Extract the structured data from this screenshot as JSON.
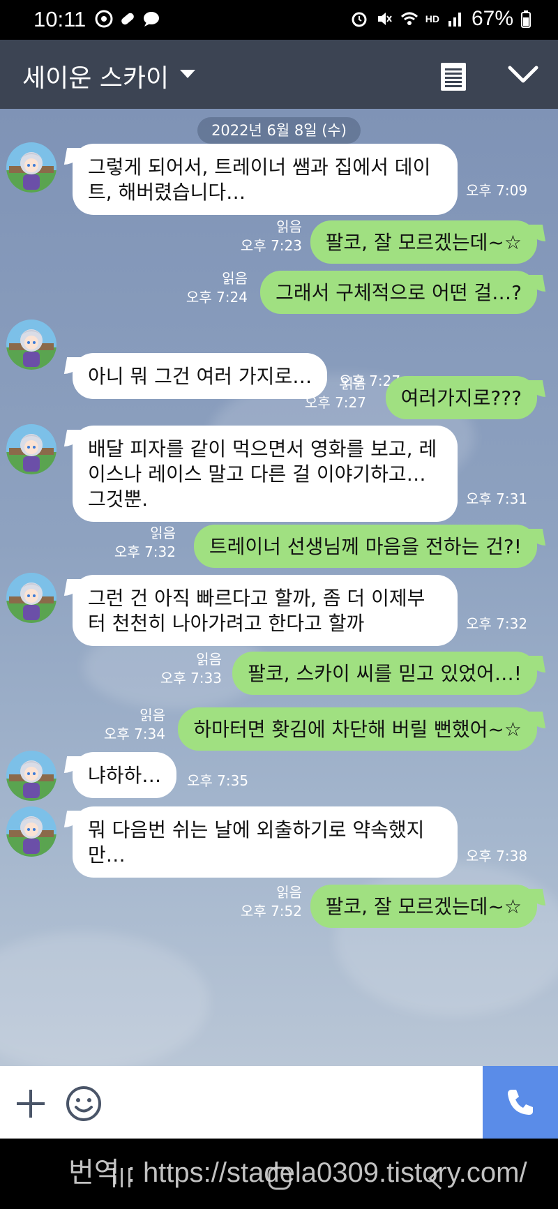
{
  "status_bar": {
    "time": "10:11",
    "battery": "67%",
    "hd_label": "HD"
  },
  "header": {
    "title": "세이운 스카이"
  },
  "chat": {
    "date": "2022년 6월 8일 (수)",
    "read_label": "읽음",
    "messages": [
      {
        "dir": "in",
        "text": "그렇게 되어서, 트레이너 쌤과 집에서 데이트, 해버렸습니다…",
        "time": "오후 7:09"
      },
      {
        "dir": "out",
        "text": "팔코, 잘 모르겠는데~☆",
        "time": "오후 7:23"
      },
      {
        "dir": "out",
        "text": "그래서 구체적으로 어떤 걸…?",
        "time": "오후 7:24"
      },
      {
        "dir": "in",
        "text": "아니 뭐 그건 여러 가지로…",
        "time": "오후 7:27"
      },
      {
        "dir": "out",
        "text": "여러가지로???",
        "time": "오후 7:27"
      },
      {
        "dir": "in",
        "text": "배달 피자를 같이 먹으면서 영화를 보고, 레이스나 레이스 말고 다른 걸 이야기하고… 그것뿐.",
        "time": "오후 7:31"
      },
      {
        "dir": "out",
        "text": "트레이너 선생님께 마음을 전하는 건?!",
        "time": "오후 7:32"
      },
      {
        "dir": "in",
        "text": "그런 건 아직 빠르다고 할까, 좀 더 이제부터 천천히 나아가려고 한다고 할까",
        "time": "오후 7:32"
      },
      {
        "dir": "out",
        "text": "팔코, 스카이 씨를 믿고 있었어…!",
        "time": "오후 7:33"
      },
      {
        "dir": "out",
        "text": "하마터면 홧김에 차단해 버릴 뻔했어~☆",
        "time": "오후 7:34"
      },
      {
        "dir": "in",
        "text": "냐하하…",
        "time": "오후 7:35"
      },
      {
        "dir": "in",
        "text": "뭐 다음번 쉬는 날에 외출하기로 약속했지만…",
        "time": "오후 7:38"
      },
      {
        "dir": "out",
        "text": "팔코, 잘 모르겠는데~☆",
        "time": "오후 7:52"
      }
    ]
  },
  "watermark": "번역 : https://stadela0309.tistory.com/",
  "colors": {
    "header": "#3c4453",
    "out_bubble": "#a0e081",
    "in_bubble": "#ffffff",
    "call": "#5a8ce8"
  },
  "icons": [
    "notes-icon",
    "chevron-down-icon",
    "plus-icon",
    "emoji-icon",
    "phone-icon"
  ]
}
